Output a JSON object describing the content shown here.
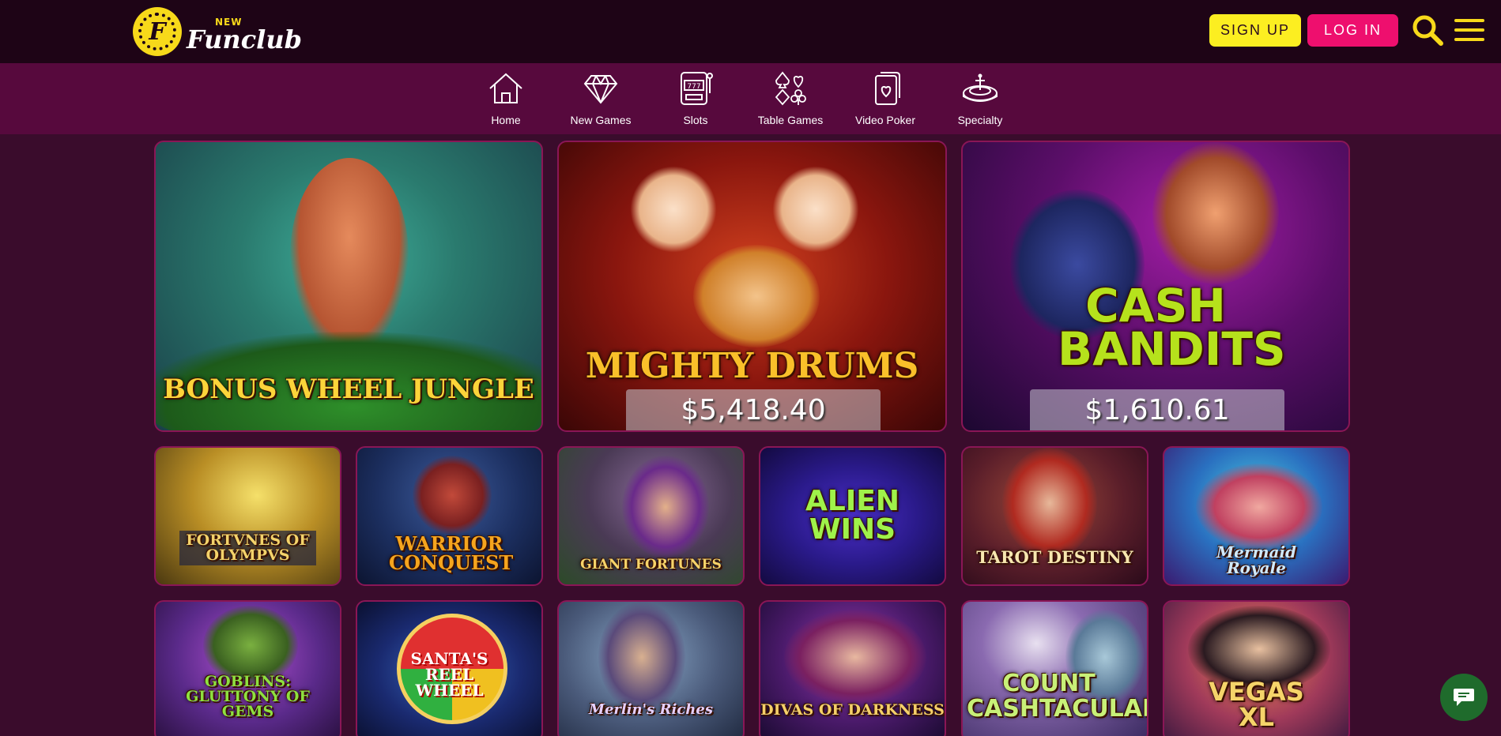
{
  "header": {
    "logo_new": "NEW",
    "logo_name": "Funclub",
    "logo_letter": "F",
    "signup_label": "SIGN UP",
    "login_label": "LOG IN",
    "icons": [
      "search-icon",
      "hamburger-menu-icon"
    ]
  },
  "categories": [
    {
      "label": "Home",
      "icon": "home-icon"
    },
    {
      "label": "New Games",
      "icon": "diamond-icon"
    },
    {
      "label": "Slots",
      "icon": "slot-machine-icon"
    },
    {
      "label": "Table Games",
      "icon": "card-suits-icon"
    },
    {
      "label": "Video Poker",
      "icon": "playing-card-icon"
    },
    {
      "label": "Specialty",
      "icon": "roulette-icon"
    }
  ],
  "featured": [
    {
      "title": "BONUS WHEEL JUNGLE",
      "jackpot": ""
    },
    {
      "title": "MIGHTY DRUMS",
      "jackpot": "$5,418.40"
    },
    {
      "title": "CASH BANDITS",
      "jackpot": "$1,610.61"
    }
  ],
  "games_row1": [
    {
      "title": "FORTVNES OF OLYMPVS"
    },
    {
      "title": "WARRIOR CONQUEST"
    },
    {
      "title": "GIANT FORTUNES"
    },
    {
      "title": "ALIEN WINS"
    },
    {
      "title": "TAROT DESTINY"
    },
    {
      "title": "Mermaid Royale"
    }
  ],
  "games_row2": [
    {
      "title": "GOBLINS: GLUTTONY OF GEMS"
    },
    {
      "title": "SANTA'S REEL WHEEL"
    },
    {
      "title": "Merlin's Riches"
    },
    {
      "title": "DIVAS OF DARKNESS"
    },
    {
      "title": "COUNT CASHTACULAR"
    },
    {
      "title": "VEGAS XL"
    }
  ],
  "colors": {
    "header_bg": "#1e0416",
    "nav_bg": "#57093d",
    "page_bg": "#3a0c2c",
    "signup": "#fcee21",
    "login": "#ee0f6e",
    "accent_yellow": "#f7d91a",
    "chat": "#1f6b2c"
  },
  "chat_icon": "chat-bubble-icon"
}
